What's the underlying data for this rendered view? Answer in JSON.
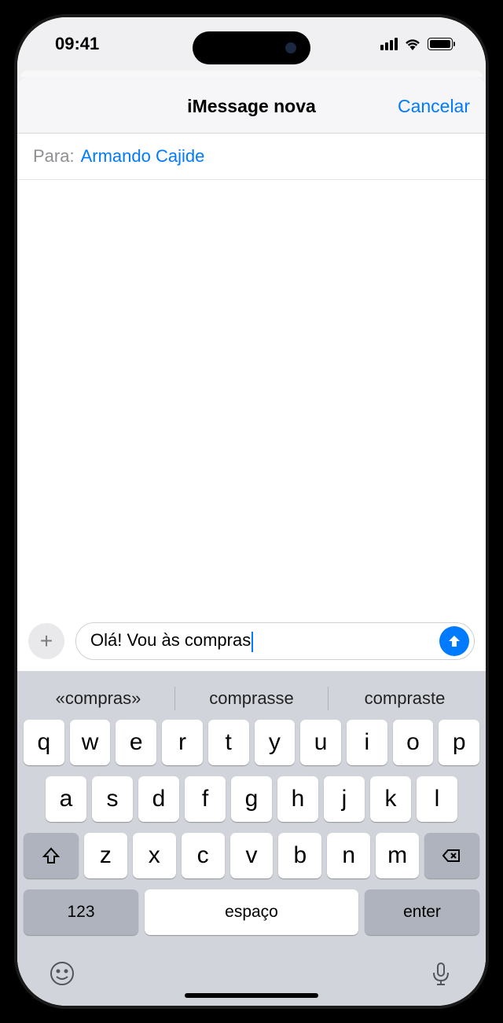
{
  "status": {
    "time": "09:41"
  },
  "header": {
    "title": "iMessage nova",
    "cancel": "Cancelar"
  },
  "toField": {
    "label": "Para:",
    "recipient": "Armando Cajide"
  },
  "compose": {
    "text": "Olá! Vou às compras"
  },
  "predictions": [
    "«compras»",
    "comprasse",
    "compraste"
  ],
  "keyboard": {
    "row1": [
      "q",
      "w",
      "e",
      "r",
      "t",
      "y",
      "u",
      "i",
      "o",
      "p"
    ],
    "row2": [
      "a",
      "s",
      "d",
      "f",
      "g",
      "h",
      "j",
      "k",
      "l"
    ],
    "row3": [
      "z",
      "x",
      "c",
      "v",
      "b",
      "n",
      "m"
    ],
    "numbers": "123",
    "space": "espaço",
    "enter": "enter"
  }
}
